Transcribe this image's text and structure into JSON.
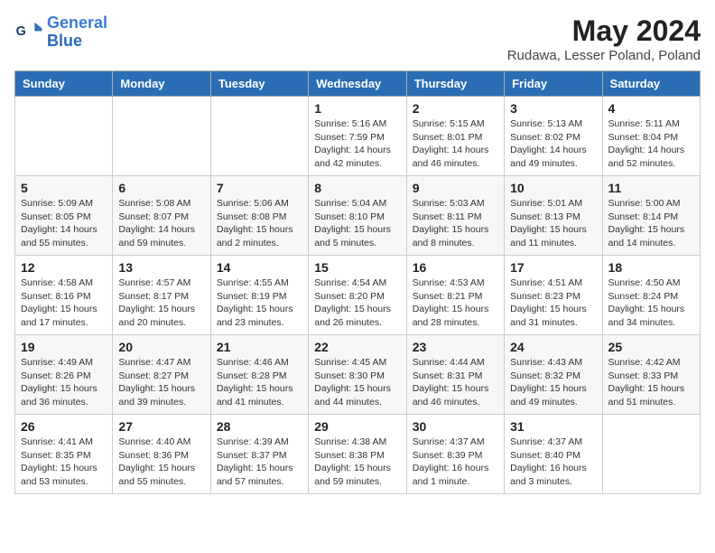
{
  "header": {
    "logo_line1": "General",
    "logo_line2": "Blue",
    "title": "May 2024",
    "subtitle": "Rudawa, Lesser Poland, Poland"
  },
  "days_of_week": [
    "Sunday",
    "Monday",
    "Tuesday",
    "Wednesday",
    "Thursday",
    "Friday",
    "Saturday"
  ],
  "weeks": [
    {
      "days": [
        {
          "num": "",
          "info": ""
        },
        {
          "num": "",
          "info": ""
        },
        {
          "num": "",
          "info": ""
        },
        {
          "num": "1",
          "info": "Sunrise: 5:16 AM\nSunset: 7:59 PM\nDaylight: 14 hours\nand 42 minutes."
        },
        {
          "num": "2",
          "info": "Sunrise: 5:15 AM\nSunset: 8:01 PM\nDaylight: 14 hours\nand 46 minutes."
        },
        {
          "num": "3",
          "info": "Sunrise: 5:13 AM\nSunset: 8:02 PM\nDaylight: 14 hours\nand 49 minutes."
        },
        {
          "num": "4",
          "info": "Sunrise: 5:11 AM\nSunset: 8:04 PM\nDaylight: 14 hours\nand 52 minutes."
        }
      ]
    },
    {
      "days": [
        {
          "num": "5",
          "info": "Sunrise: 5:09 AM\nSunset: 8:05 PM\nDaylight: 14 hours\nand 55 minutes."
        },
        {
          "num": "6",
          "info": "Sunrise: 5:08 AM\nSunset: 8:07 PM\nDaylight: 14 hours\nand 59 minutes."
        },
        {
          "num": "7",
          "info": "Sunrise: 5:06 AM\nSunset: 8:08 PM\nDaylight: 15 hours\nand 2 minutes."
        },
        {
          "num": "8",
          "info": "Sunrise: 5:04 AM\nSunset: 8:10 PM\nDaylight: 15 hours\nand 5 minutes."
        },
        {
          "num": "9",
          "info": "Sunrise: 5:03 AM\nSunset: 8:11 PM\nDaylight: 15 hours\nand 8 minutes."
        },
        {
          "num": "10",
          "info": "Sunrise: 5:01 AM\nSunset: 8:13 PM\nDaylight: 15 hours\nand 11 minutes."
        },
        {
          "num": "11",
          "info": "Sunrise: 5:00 AM\nSunset: 8:14 PM\nDaylight: 15 hours\nand 14 minutes."
        }
      ]
    },
    {
      "days": [
        {
          "num": "12",
          "info": "Sunrise: 4:58 AM\nSunset: 8:16 PM\nDaylight: 15 hours\nand 17 minutes."
        },
        {
          "num": "13",
          "info": "Sunrise: 4:57 AM\nSunset: 8:17 PM\nDaylight: 15 hours\nand 20 minutes."
        },
        {
          "num": "14",
          "info": "Sunrise: 4:55 AM\nSunset: 8:19 PM\nDaylight: 15 hours\nand 23 minutes."
        },
        {
          "num": "15",
          "info": "Sunrise: 4:54 AM\nSunset: 8:20 PM\nDaylight: 15 hours\nand 26 minutes."
        },
        {
          "num": "16",
          "info": "Sunrise: 4:53 AM\nSunset: 8:21 PM\nDaylight: 15 hours\nand 28 minutes."
        },
        {
          "num": "17",
          "info": "Sunrise: 4:51 AM\nSunset: 8:23 PM\nDaylight: 15 hours\nand 31 minutes."
        },
        {
          "num": "18",
          "info": "Sunrise: 4:50 AM\nSunset: 8:24 PM\nDaylight: 15 hours\nand 34 minutes."
        }
      ]
    },
    {
      "days": [
        {
          "num": "19",
          "info": "Sunrise: 4:49 AM\nSunset: 8:26 PM\nDaylight: 15 hours\nand 36 minutes."
        },
        {
          "num": "20",
          "info": "Sunrise: 4:47 AM\nSunset: 8:27 PM\nDaylight: 15 hours\nand 39 minutes."
        },
        {
          "num": "21",
          "info": "Sunrise: 4:46 AM\nSunset: 8:28 PM\nDaylight: 15 hours\nand 41 minutes."
        },
        {
          "num": "22",
          "info": "Sunrise: 4:45 AM\nSunset: 8:30 PM\nDaylight: 15 hours\nand 44 minutes."
        },
        {
          "num": "23",
          "info": "Sunrise: 4:44 AM\nSunset: 8:31 PM\nDaylight: 15 hours\nand 46 minutes."
        },
        {
          "num": "24",
          "info": "Sunrise: 4:43 AM\nSunset: 8:32 PM\nDaylight: 15 hours\nand 49 minutes."
        },
        {
          "num": "25",
          "info": "Sunrise: 4:42 AM\nSunset: 8:33 PM\nDaylight: 15 hours\nand 51 minutes."
        }
      ]
    },
    {
      "days": [
        {
          "num": "26",
          "info": "Sunrise: 4:41 AM\nSunset: 8:35 PM\nDaylight: 15 hours\nand 53 minutes."
        },
        {
          "num": "27",
          "info": "Sunrise: 4:40 AM\nSunset: 8:36 PM\nDaylight: 15 hours\nand 55 minutes."
        },
        {
          "num": "28",
          "info": "Sunrise: 4:39 AM\nSunset: 8:37 PM\nDaylight: 15 hours\nand 57 minutes."
        },
        {
          "num": "29",
          "info": "Sunrise: 4:38 AM\nSunset: 8:38 PM\nDaylight: 15 hours\nand 59 minutes."
        },
        {
          "num": "30",
          "info": "Sunrise: 4:37 AM\nSunset: 8:39 PM\nDaylight: 16 hours\nand 1 minute."
        },
        {
          "num": "31",
          "info": "Sunrise: 4:37 AM\nSunset: 8:40 PM\nDaylight: 16 hours\nand 3 minutes."
        },
        {
          "num": "",
          "info": ""
        }
      ]
    }
  ]
}
